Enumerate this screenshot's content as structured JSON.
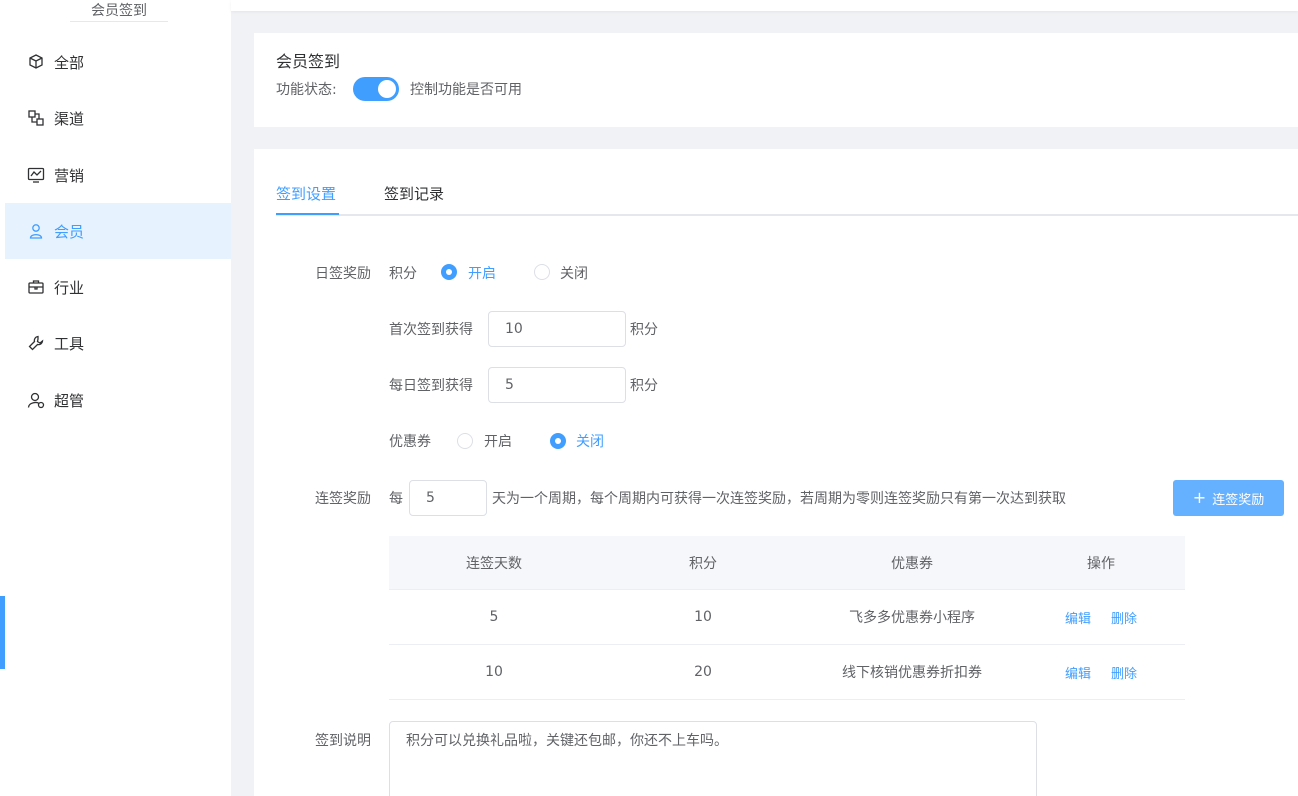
{
  "sidebar": {
    "header": "会员签到",
    "items": [
      {
        "label": "全部",
        "icon": "cube-icon"
      },
      {
        "label": "渠道",
        "icon": "channel-icon"
      },
      {
        "label": "营销",
        "icon": "chart-monitor-icon"
      },
      {
        "label": "会员",
        "icon": "user-icon"
      },
      {
        "label": "行业",
        "icon": "briefcase-icon"
      },
      {
        "label": "工具",
        "icon": "wrench-icon"
      },
      {
        "label": "超管",
        "icon": "admin-user-icon"
      }
    ],
    "active_index": 3
  },
  "header": {
    "title": "会员签到",
    "status_label": "功能状态:",
    "status_on": true,
    "status_desc": "控制功能是否可用"
  },
  "tabs": [
    {
      "label": "签到设置",
      "active": true
    },
    {
      "label": "签到记录",
      "active": false
    }
  ],
  "daily": {
    "label": "日签奖励",
    "points_label": "积分",
    "on_label": "开启",
    "off_label": "关闭",
    "points_enabled": true,
    "first_label": "首次签到获得",
    "first_value": "10",
    "first_unit": "积分",
    "daily_label": "每日签到获得",
    "daily_value": "5",
    "daily_unit": "积分",
    "coupon_label": "优惠券",
    "coupon_on_label": "开启",
    "coupon_off_label": "关闭",
    "coupon_enabled": false
  },
  "streak": {
    "label": "连签奖励",
    "prefix": "每",
    "period_value": "5",
    "suffix": "天为一个周期，每个周期内可获得一次连签奖励，若周期为零则连签奖励只有第一次达到获取",
    "add_button": "连签奖励"
  },
  "table": {
    "headers": [
      "连签天数",
      "积分",
      "优惠券",
      "操作"
    ],
    "rows": [
      {
        "days": "5",
        "points": "10",
        "coupon": "飞多多优惠券小程序",
        "edit": "编辑",
        "delete": "删除"
      },
      {
        "days": "10",
        "points": "20",
        "coupon": "线下核销优惠券折扣券",
        "edit": "编辑",
        "delete": "删除"
      }
    ]
  },
  "description": {
    "label": "签到说明",
    "value": "积分可以兑换礼品啦，关键还包邮，你还不上车吗。"
  },
  "colors": {
    "accent": "#409eff",
    "active_bg": "#e6f3ff"
  }
}
